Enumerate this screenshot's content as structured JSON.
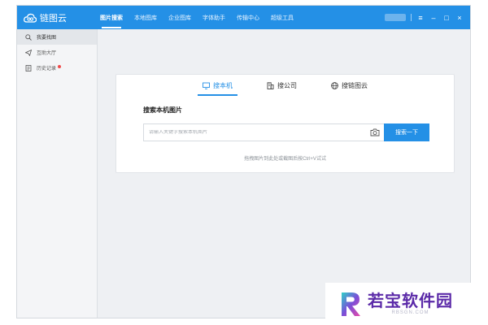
{
  "app": {
    "title": "链图云"
  },
  "nav": {
    "items": [
      {
        "label": "图片搜索",
        "active": true
      },
      {
        "label": "本地图库",
        "active": false
      },
      {
        "label": "企业图库",
        "active": false
      },
      {
        "label": "字体助手",
        "active": false
      },
      {
        "label": "传输中心",
        "active": false
      },
      {
        "label": "超级工具",
        "active": false
      }
    ]
  },
  "window_controls": {
    "menu": "≡",
    "minimize": "–",
    "maximize": "□",
    "close": "×"
  },
  "sidebar": {
    "items": [
      {
        "label": "我要找图",
        "icon": "search-icon",
        "active": true
      },
      {
        "label": "互助大厅",
        "icon": "send-icon",
        "active": false
      },
      {
        "label": "历史记录",
        "icon": "history-icon",
        "active": false,
        "badge": true
      }
    ]
  },
  "tabs": [
    {
      "label": "搜本机",
      "icon": "monitor-icon",
      "active": true
    },
    {
      "label": "搜公司",
      "icon": "building-icon",
      "active": false
    },
    {
      "label": "搜链图云",
      "icon": "globe-icon",
      "active": false
    }
  ],
  "search": {
    "section_title": "搜索本机图片",
    "placeholder": "请输入关键字搜索本机图片",
    "value": "",
    "button_label": "搜索一下",
    "hint": "拖拽图片到此处或截图后按Ctrl+V试试"
  },
  "watermark": {
    "title": "若宝软件园",
    "url": "RBSGN.COM"
  },
  "colors": {
    "accent": "#2490e6",
    "badge": "#f04a4a",
    "watermark": "#5b2aa8"
  }
}
